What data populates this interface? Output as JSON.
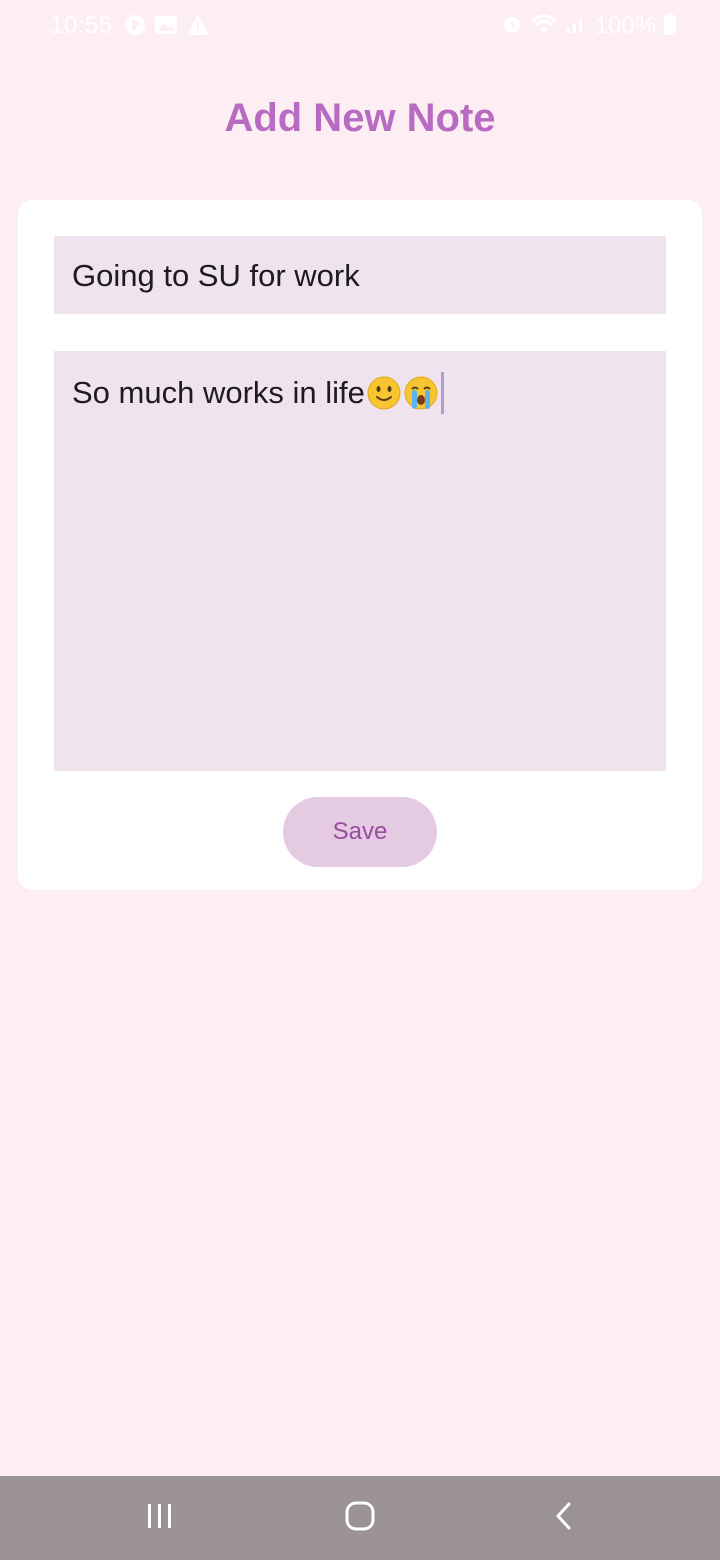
{
  "status_bar": {
    "time": "10:55",
    "battery_text": "100%",
    "left_icons": [
      "app-notification-icon",
      "gallery-icon",
      "warning-icon"
    ],
    "right_icons": [
      "alarm-icon",
      "wifi-icon",
      "signal-icon",
      "battery-icon"
    ]
  },
  "header": {
    "title": "Add New Note"
  },
  "form": {
    "title_value": "Going to SU for work",
    "content_value": "So much works in life",
    "content_emojis": [
      "slightly-smiling-face-icon",
      "crying-face-icon"
    ],
    "save_label": "Save"
  },
  "nav_bar": {
    "buttons": [
      "recent-apps-icon",
      "home-icon",
      "back-icon"
    ]
  },
  "colors": {
    "background": "#fdeef4",
    "accent": "#b86bc2",
    "field_background": "#efe4ee",
    "button_background": "#e5cbe2",
    "button_text": "#9a4ba0",
    "nav_bar": "#9b9295"
  }
}
